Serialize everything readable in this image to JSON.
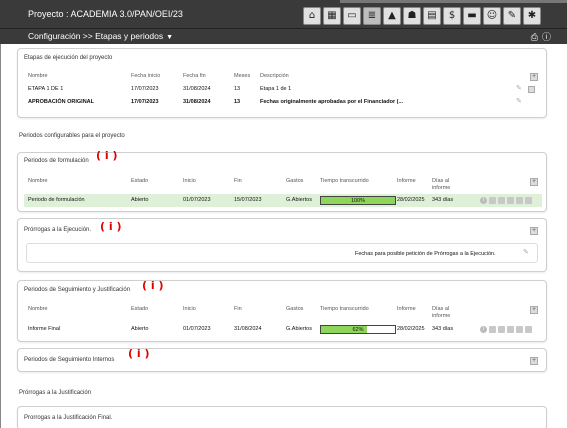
{
  "header": {
    "project_title": "Proyecto : ACADEMIA 3.0/PAN/OEI/23",
    "toolbar_icons": [
      "home-icon",
      "grid-icon",
      "window-icon",
      "database-icon",
      "building-icon",
      "handshake-icon",
      "calendar-icon",
      "money-bag-icon",
      "folder-icon",
      "people-icon",
      "tools-icon",
      "user-settings-icon"
    ]
  },
  "breadcrumb": {
    "text": "Configuración >> Etapas y periodos"
  },
  "etapas": {
    "title": "Etapas de ejecución del proyecto",
    "columns": [
      "Nombre",
      "Fecha inicio",
      "Fecha fin",
      "Meses",
      "Descripción"
    ],
    "rows": [
      {
        "nombre": "ETAPA 1 DE 1",
        "inicio": "17/07/2023",
        "fin": "31/08/2024",
        "meses": "13",
        "descripcion": "Etapa 1 de 1"
      },
      {
        "nombre": "APROBACIÓN ORIGINAL",
        "inicio": "17/07/2023",
        "fin": "31/08/2024",
        "meses": "13",
        "descripcion": "Fechas originalmente aprobadas por el Financiador (..."
      }
    ]
  },
  "periodos_section_title": "Periodos configurables para el proyecto",
  "formulacion": {
    "title": "Periodos de formulación",
    "columns": [
      "Nombre",
      "Estado",
      "Inicio",
      "Fin",
      "Gastos",
      "Tiempo transcurrido",
      "Informe",
      "Días al",
      "informe"
    ],
    "row": {
      "nombre": "Periodo de formulación",
      "estado": "Abierto",
      "inicio": "01/07/2023",
      "fin": "15/07/2023",
      "gastos": "G.Abiertos",
      "progress": 100,
      "progress_label": "100%",
      "informe": "28/02/2025",
      "dias": "343 días"
    }
  },
  "prorrogas_ejecucion": {
    "title": "Prórrogas a la Ejecución.",
    "message": "Fechas para posible petición de Prórrogas a la Ejecución."
  },
  "seguimiento": {
    "title": "Periodos de Seguimiento y Justificación",
    "columns": [
      "Nombre",
      "Estado",
      "Inicio",
      "Fin",
      "Gastos",
      "Tiempo transcurrido",
      "Informe",
      "Días al",
      "informe"
    ],
    "row": {
      "nombre": "Informe Final",
      "estado": "Abierto",
      "inicio": "01/07/2023",
      "fin": "31/08/2024",
      "gastos": "G.Abiertos",
      "progress": 62,
      "progress_label": "62%",
      "informe": "28/02/2025",
      "dias": "343 días"
    }
  },
  "seguimiento_internos": {
    "title": "Periodos de Seguimiento Internos"
  },
  "prorrogas_justificacion_section": "Prórrogas a la Justificación",
  "prorrogas_justificacion": {
    "title": "Prorrogas a la Justificación Final."
  },
  "annotation_mark": "( i )",
  "colors": {
    "progress_fill": "#8ed65b",
    "row_highlight": "#dff0d8",
    "annotation": "#e00000"
  }
}
